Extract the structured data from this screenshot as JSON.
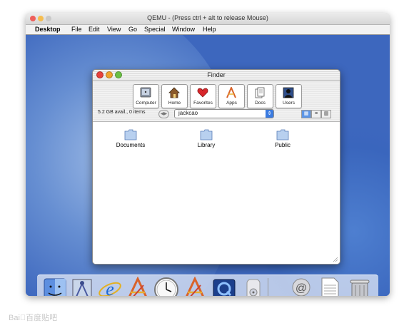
{
  "host": {
    "title": "QEMU - (Press ctrl + alt to release Mouse)",
    "colors": {
      "close": "#ee5f5b",
      "minimize": "#f5bd4f",
      "zoom": "#c9c9c9"
    }
  },
  "menubar": {
    "items": [
      "Desktop",
      "File",
      "Edit",
      "View",
      "Go",
      "Special",
      "Window",
      "Help"
    ]
  },
  "finder": {
    "title": "Finder",
    "toolbar": [
      {
        "label": "Computer",
        "icon": "computer-icon"
      },
      {
        "label": "Home",
        "icon": "home-icon"
      },
      {
        "label": "Favorites",
        "icon": "heart-icon"
      },
      {
        "label": "Apps",
        "icon": "apps-icon"
      },
      {
        "label": "Docs",
        "icon": "documents-icon"
      },
      {
        "label": "Users",
        "icon": "users-icon"
      }
    ],
    "status": "5.2 GB avail., 0 items",
    "path": "jackcao",
    "folders": [
      "Documents",
      "Library",
      "Public"
    ],
    "views": [
      "icon-view",
      "list-view",
      "column-view"
    ],
    "selected_view": "icon-view"
  },
  "dock": {
    "items": [
      "finder-icon",
      "mail-icon",
      "internet-explorer-icon",
      "apps-icon",
      "clock-icon",
      "apps-icon",
      "quicktime-icon",
      "speaker-icon",
      "mail-at-icon",
      "text-document-icon",
      "trash-icon"
    ]
  },
  "watermark": "Bai\u0000百度贴吧"
}
